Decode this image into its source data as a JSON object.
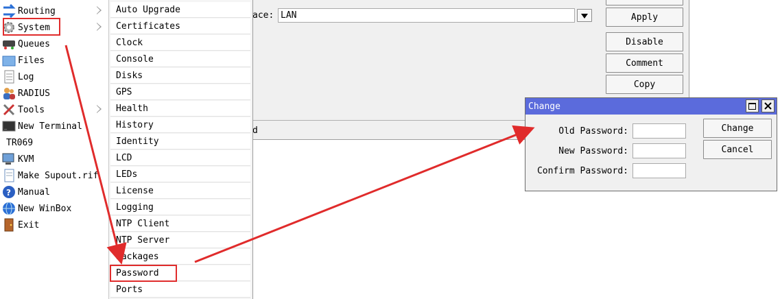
{
  "sidebar": {
    "items": [
      {
        "label": "Routing",
        "icon": "routing-icon",
        "submenu": true
      },
      {
        "label": "System",
        "icon": "gear-icon",
        "submenu": true
      },
      {
        "label": "Queues",
        "icon": "queues-icon",
        "submenu": false
      },
      {
        "label": "Files",
        "icon": "folder-icon",
        "submenu": false
      },
      {
        "label": "Log",
        "icon": "log-icon",
        "submenu": false
      },
      {
        "label": "RADIUS",
        "icon": "users-icon",
        "submenu": false
      },
      {
        "label": "Tools",
        "icon": "tools-icon",
        "submenu": true
      },
      {
        "label": "New Terminal",
        "icon": "terminal-icon",
        "submenu": false
      },
      {
        "label": "TR069",
        "icon": "",
        "submenu": false
      },
      {
        "label": "KVM",
        "icon": "kvm-icon",
        "submenu": false
      },
      {
        "label": "Make Supout.rif",
        "icon": "document-icon",
        "submenu": false
      },
      {
        "label": "Manual",
        "icon": "help-icon",
        "submenu": false
      },
      {
        "label": "New WinBox",
        "icon": "globe-icon",
        "submenu": false
      },
      {
        "label": "Exit",
        "icon": "exit-door-icon",
        "submenu": false
      }
    ]
  },
  "submenu": {
    "items": [
      "Auto Upgrade",
      "Certificates",
      "Clock",
      "Console",
      "Disks",
      "GPS",
      "Health",
      "History",
      "Identity",
      "LCD",
      "LEDs",
      "License",
      "Logging",
      "NTP Client",
      "NTP Server",
      "Packages",
      "Password",
      "Ports"
    ]
  },
  "background_window": {
    "interface_label": "ace:",
    "interface_value": "LAN",
    "buttons": [
      "Apply",
      "Disable",
      "Comment",
      "Copy"
    ],
    "status_text": "d"
  },
  "dialog": {
    "title": "Change",
    "fields": [
      {
        "label": "Old Password:",
        "value": ""
      },
      {
        "label": "New Password:",
        "value": ""
      },
      {
        "label": "Confirm Password:",
        "value": ""
      }
    ],
    "change_label": "Change",
    "cancel_label": "Cancel"
  },
  "colors": {
    "titlebar": "#5b6bdc",
    "annotation_red": "#e02b2b"
  }
}
